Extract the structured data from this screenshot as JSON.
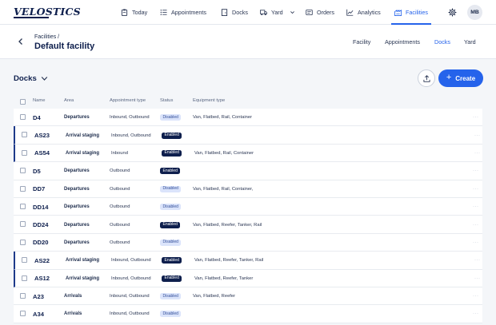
{
  "brand": {
    "logo": "VELOSTICS"
  },
  "nav": {
    "items": [
      {
        "label": "Today",
        "icon": "clipboard-icon"
      },
      {
        "label": "Appointments",
        "icon": "list-icon"
      },
      {
        "label": "Docks",
        "icon": "door-icon"
      },
      {
        "label": "Yard",
        "icon": "truck-icon"
      },
      {
        "label": "Orders",
        "icon": "order-icon"
      },
      {
        "label": "Analytics",
        "icon": "chart-icon"
      },
      {
        "label": "Facilities",
        "icon": "facility-icon"
      }
    ],
    "active": "Facilities",
    "user_initials": "MB"
  },
  "header": {
    "breadcrumb": "Facilities /",
    "title": "Default facility",
    "tabs": [
      "Facility",
      "Appointments",
      "Docks",
      "Yard"
    ],
    "active_tab": "Docks"
  },
  "section": {
    "title": "Docks",
    "create_label": "Create"
  },
  "table": {
    "columns": [
      "Name",
      "Area",
      "Appointment type",
      "Status",
      "Equipment type"
    ],
    "rows": [
      {
        "name": "D4",
        "area": "Departures",
        "appointment_type": "Inbound, Outbound",
        "status": "Disabled",
        "equipment": "Van, Flatbed, Rail, Container",
        "flag": false
      },
      {
        "name": "AS23",
        "area": "Arrival staging",
        "appointment_type": "Inbound, Outbound",
        "status": "Enabled",
        "equipment": "",
        "flag": true
      },
      {
        "name": "AS54",
        "area": "Arrival staging",
        "appointment_type": "Inbound",
        "status": "Enabled",
        "equipment": "Van, Flatbed, Rail, Container",
        "flag": true
      },
      {
        "name": "D5",
        "area": "Departures",
        "appointment_type": "Outbound",
        "status": "Enabled",
        "equipment": "",
        "flag": false
      },
      {
        "name": "DD7",
        "area": "Departures",
        "appointment_type": "Outbound",
        "status": "Disabled",
        "equipment": "Van, Flatbed, Rail, Container,",
        "flag": false
      },
      {
        "name": "DD14",
        "area": "Departures",
        "appointment_type": "Outbound",
        "status": "Disabled",
        "equipment": "",
        "flag": false
      },
      {
        "name": "DD24",
        "area": "Departures",
        "appointment_type": "Outbound",
        "status": "Enabled",
        "equipment": "Van, Flatbed, Reefer, Tanker, Rail",
        "flag": false
      },
      {
        "name": "DD20",
        "area": "Departures",
        "appointment_type": "Outbound",
        "status": "Disabled",
        "equipment": "",
        "flag": false
      },
      {
        "name": "AS22",
        "area": "Arrival staging",
        "appointment_type": "Inbound, Outbound",
        "status": "Enabled",
        "equipment": "Van, Flatbed, Reefer, Tanker, Rail",
        "flag": true
      },
      {
        "name": "AS12",
        "area": "Arrival staging",
        "appointment_type": "Inbound, Outbound",
        "status": "Enabled",
        "equipment": "Van, Flatbed, Reefer, Tanker",
        "flag": true
      },
      {
        "name": "A23",
        "area": "Arrivals",
        "appointment_type": "Inbound, Outbound",
        "status": "Disabled",
        "equipment": "Van, Flatbed, Reefer",
        "flag": false
      },
      {
        "name": "A34",
        "area": "Arrivals",
        "appointment_type": "Inbound, Outbound",
        "status": "Disabled",
        "equipment": "",
        "flag": false
      }
    ]
  },
  "colors": {
    "accent": "#2563eb",
    "navy": "#0e1f4d",
    "badge_enabled": "#0e1f4d",
    "badge_disabled": "#dbe4fb"
  }
}
